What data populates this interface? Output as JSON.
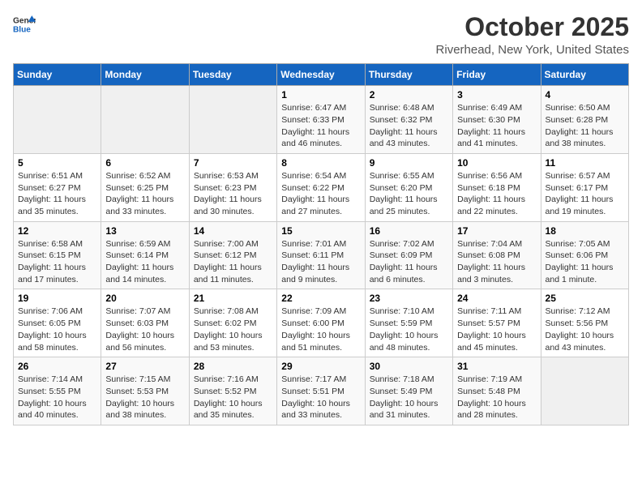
{
  "header": {
    "logo_general": "General",
    "logo_blue": "Blue",
    "month_title": "October 2025",
    "location": "Riverhead, New York, United States"
  },
  "days_of_week": [
    "Sunday",
    "Monday",
    "Tuesday",
    "Wednesday",
    "Thursday",
    "Friday",
    "Saturday"
  ],
  "weeks": [
    [
      {
        "day": "",
        "info": ""
      },
      {
        "day": "",
        "info": ""
      },
      {
        "day": "",
        "info": ""
      },
      {
        "day": "1",
        "info": "Sunrise: 6:47 AM\nSunset: 6:33 PM\nDaylight: 11 hours\nand 46 minutes."
      },
      {
        "day": "2",
        "info": "Sunrise: 6:48 AM\nSunset: 6:32 PM\nDaylight: 11 hours\nand 43 minutes."
      },
      {
        "day": "3",
        "info": "Sunrise: 6:49 AM\nSunset: 6:30 PM\nDaylight: 11 hours\nand 41 minutes."
      },
      {
        "day": "4",
        "info": "Sunrise: 6:50 AM\nSunset: 6:28 PM\nDaylight: 11 hours\nand 38 minutes."
      }
    ],
    [
      {
        "day": "5",
        "info": "Sunrise: 6:51 AM\nSunset: 6:27 PM\nDaylight: 11 hours\nand 35 minutes."
      },
      {
        "day": "6",
        "info": "Sunrise: 6:52 AM\nSunset: 6:25 PM\nDaylight: 11 hours\nand 33 minutes."
      },
      {
        "day": "7",
        "info": "Sunrise: 6:53 AM\nSunset: 6:23 PM\nDaylight: 11 hours\nand 30 minutes."
      },
      {
        "day": "8",
        "info": "Sunrise: 6:54 AM\nSunset: 6:22 PM\nDaylight: 11 hours\nand 27 minutes."
      },
      {
        "day": "9",
        "info": "Sunrise: 6:55 AM\nSunset: 6:20 PM\nDaylight: 11 hours\nand 25 minutes."
      },
      {
        "day": "10",
        "info": "Sunrise: 6:56 AM\nSunset: 6:18 PM\nDaylight: 11 hours\nand 22 minutes."
      },
      {
        "day": "11",
        "info": "Sunrise: 6:57 AM\nSunset: 6:17 PM\nDaylight: 11 hours\nand 19 minutes."
      }
    ],
    [
      {
        "day": "12",
        "info": "Sunrise: 6:58 AM\nSunset: 6:15 PM\nDaylight: 11 hours\nand 17 minutes."
      },
      {
        "day": "13",
        "info": "Sunrise: 6:59 AM\nSunset: 6:14 PM\nDaylight: 11 hours\nand 14 minutes."
      },
      {
        "day": "14",
        "info": "Sunrise: 7:00 AM\nSunset: 6:12 PM\nDaylight: 11 hours\nand 11 minutes."
      },
      {
        "day": "15",
        "info": "Sunrise: 7:01 AM\nSunset: 6:11 PM\nDaylight: 11 hours\nand 9 minutes."
      },
      {
        "day": "16",
        "info": "Sunrise: 7:02 AM\nSunset: 6:09 PM\nDaylight: 11 hours\nand 6 minutes."
      },
      {
        "day": "17",
        "info": "Sunrise: 7:04 AM\nSunset: 6:08 PM\nDaylight: 11 hours\nand 3 minutes."
      },
      {
        "day": "18",
        "info": "Sunrise: 7:05 AM\nSunset: 6:06 PM\nDaylight: 11 hours\nand 1 minute."
      }
    ],
    [
      {
        "day": "19",
        "info": "Sunrise: 7:06 AM\nSunset: 6:05 PM\nDaylight: 10 hours\nand 58 minutes."
      },
      {
        "day": "20",
        "info": "Sunrise: 7:07 AM\nSunset: 6:03 PM\nDaylight: 10 hours\nand 56 minutes."
      },
      {
        "day": "21",
        "info": "Sunrise: 7:08 AM\nSunset: 6:02 PM\nDaylight: 10 hours\nand 53 minutes."
      },
      {
        "day": "22",
        "info": "Sunrise: 7:09 AM\nSunset: 6:00 PM\nDaylight: 10 hours\nand 51 minutes."
      },
      {
        "day": "23",
        "info": "Sunrise: 7:10 AM\nSunset: 5:59 PM\nDaylight: 10 hours\nand 48 minutes."
      },
      {
        "day": "24",
        "info": "Sunrise: 7:11 AM\nSunset: 5:57 PM\nDaylight: 10 hours\nand 45 minutes."
      },
      {
        "day": "25",
        "info": "Sunrise: 7:12 AM\nSunset: 5:56 PM\nDaylight: 10 hours\nand 43 minutes."
      }
    ],
    [
      {
        "day": "26",
        "info": "Sunrise: 7:14 AM\nSunset: 5:55 PM\nDaylight: 10 hours\nand 40 minutes."
      },
      {
        "day": "27",
        "info": "Sunrise: 7:15 AM\nSunset: 5:53 PM\nDaylight: 10 hours\nand 38 minutes."
      },
      {
        "day": "28",
        "info": "Sunrise: 7:16 AM\nSunset: 5:52 PM\nDaylight: 10 hours\nand 35 minutes."
      },
      {
        "day": "29",
        "info": "Sunrise: 7:17 AM\nSunset: 5:51 PM\nDaylight: 10 hours\nand 33 minutes."
      },
      {
        "day": "30",
        "info": "Sunrise: 7:18 AM\nSunset: 5:49 PM\nDaylight: 10 hours\nand 31 minutes."
      },
      {
        "day": "31",
        "info": "Sunrise: 7:19 AM\nSunset: 5:48 PM\nDaylight: 10 hours\nand 28 minutes."
      },
      {
        "day": "",
        "info": ""
      }
    ]
  ]
}
